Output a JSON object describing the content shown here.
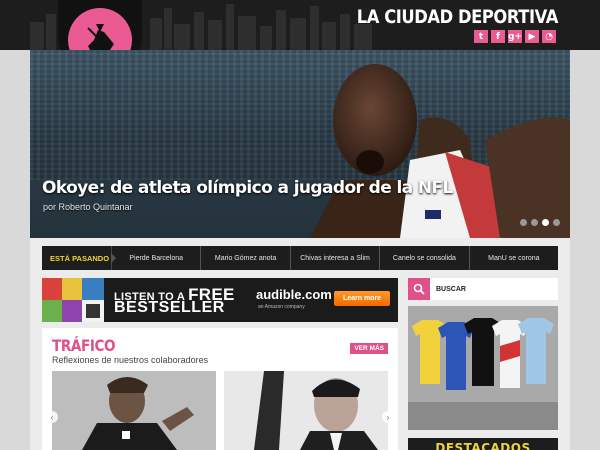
{
  "site": {
    "title": "LA CIUDAD DEPORTIVA",
    "social": [
      {
        "icon": "twitter-icon",
        "glyph": "t"
      },
      {
        "icon": "facebook-icon",
        "glyph": "f"
      },
      {
        "icon": "google-plus-icon",
        "glyph": "g+"
      },
      {
        "icon": "youtube-icon",
        "glyph": "▶"
      },
      {
        "icon": "rss-icon",
        "glyph": "◔"
      }
    ],
    "accent": "#ea5b93",
    "highlight": "#f0d33a"
  },
  "hero": {
    "title": "Okoye: de atleta olímpico a jugador de la NFL",
    "author": "por Roberto Quintanar",
    "slide_count": 4,
    "active_slide": 3
  },
  "ticker": {
    "label": "ESTÁ PASANDO",
    "items": [
      "Pierde Barcelona",
      "Mario Gómez anota",
      "Chivas interesa a Slim",
      "Canelo se consolida",
      "ManU se corona"
    ]
  },
  "ad": {
    "listen": "LISTEN TO A",
    "free": "FREE",
    "bestseller": "BESTSELLER",
    "brand": "audible.com",
    "brand_sub": "an Amazon company",
    "cta": "Learn more"
  },
  "trafico": {
    "title": "TRÁFICO",
    "subtitle": "Reflexiones de nuestros colaboradores",
    "more": "VER MÁS"
  },
  "sidebar": {
    "search_label": "BUSCAR",
    "featured": "DESTACADOS"
  }
}
